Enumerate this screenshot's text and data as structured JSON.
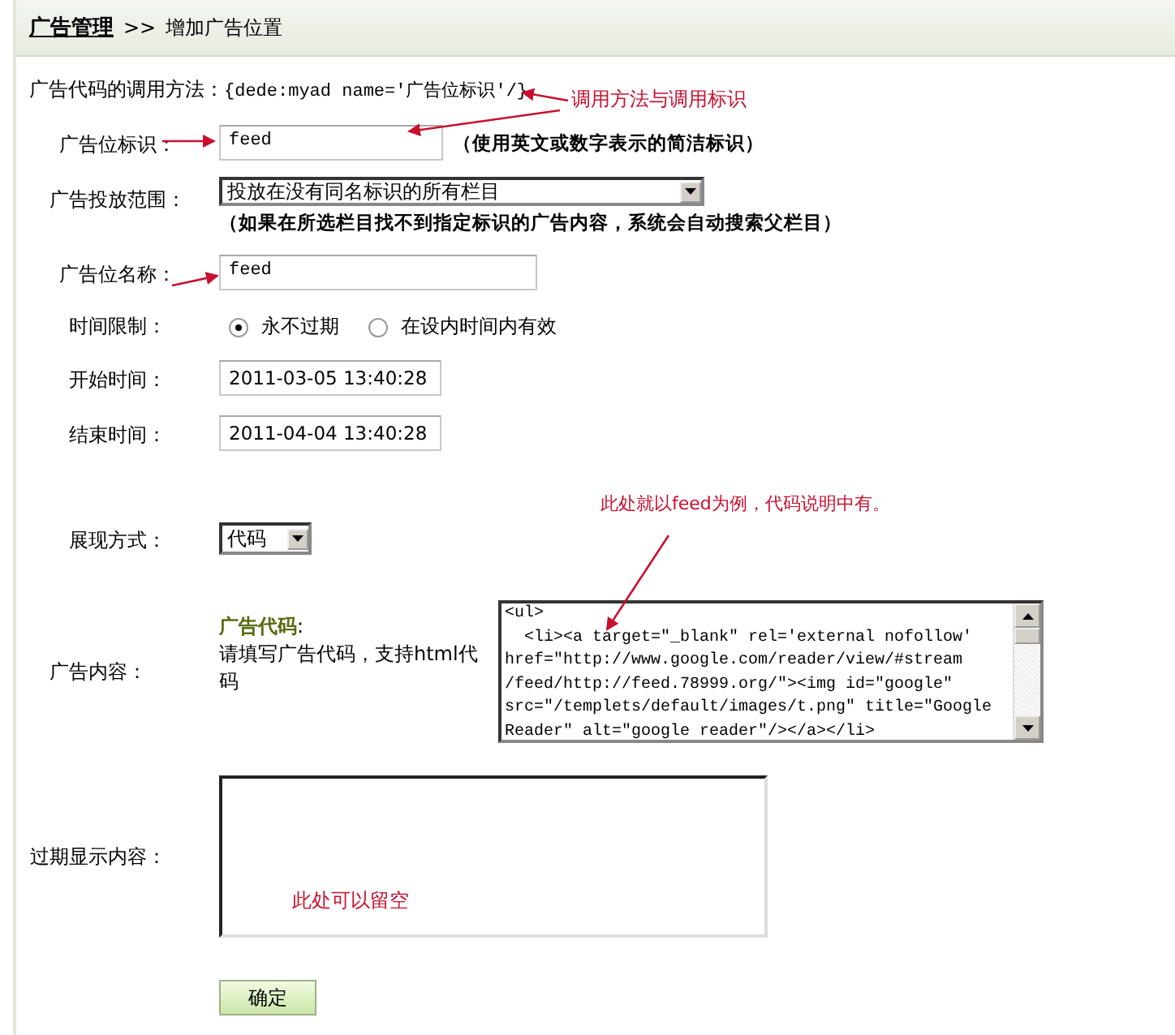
{
  "breadcrumb": {
    "section": "广告管理",
    "separator": ">>",
    "page": "增加广告位置"
  },
  "usage": {
    "label": "广告代码的调用方法：",
    "code": "{dede:myad name='广告位标识'/}"
  },
  "fields": [
    {
      "kind": "text",
      "label": "广告位标识：",
      "value": "feed",
      "note": "（使用英文或数字表示的简洁标识）"
    },
    {
      "kind": "select",
      "label": "广告投放范围：",
      "value": "投放在没有同名标识的所有栏目",
      "note": "（如果在所选栏目找不到指定标识的广告内容，系统会自动搜索父栏目）"
    },
    {
      "kind": "text",
      "label": "广告位名称：",
      "value": "feed"
    },
    {
      "kind": "radio",
      "label": "时间限制：",
      "options": [
        {
          "label": "永不过期",
          "selected": true
        },
        {
          "label": "在设内时间内有效",
          "selected": false
        }
      ]
    },
    {
      "kind": "date",
      "label": "开始时间：",
      "value": "2011-03-05 13:40:28"
    },
    {
      "kind": "date",
      "label": "结束时间：",
      "value": "2011-04-04 13:40:28"
    },
    {
      "kind": "small-select",
      "label": "展现方式：",
      "value": "代码"
    },
    {
      "kind": "code",
      "label": "广告内容：",
      "hint_title": "广告代码",
      "hint_colon": ":",
      "hint": "请填写广告代码，支持html代码",
      "lines": [
        "<ul>",
        "  <li><a target=\"_blank\" rel='external nofollow'",
        "href=\"http://www.google.com/reader/view/#stream",
        "/feed/http://feed.78999.org/\"><img id=\"google\"",
        "src=\"/templets/default/images/t.png\" title=\"Google",
        "Reader\" alt=\"google reader\"/></a></li>"
      ]
    },
    {
      "kind": "area",
      "label": "过期显示内容："
    }
  ],
  "submit": "确定",
  "annotations": [
    "调用方法与调用标识",
    "此处就以feed为例，代码说明中有。",
    "此处可以留空"
  ]
}
